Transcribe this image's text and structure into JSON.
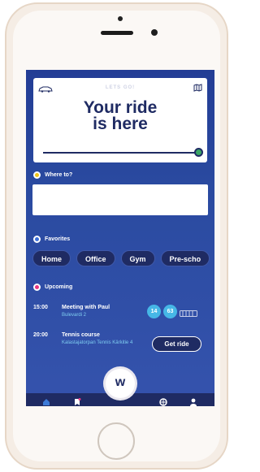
{
  "card": {
    "tagline": "LETS GO!",
    "title": "Your ride is here",
    "ride_progress": 1.0
  },
  "destination": {
    "label": "Where to?",
    "value": "",
    "placeholder": ""
  },
  "favorites": {
    "label": "Favorites",
    "items": [
      "Home",
      "Office",
      "Gym",
      "Pre-scho"
    ]
  },
  "upcoming": {
    "label": "Upcoming",
    "events": [
      {
        "time": "15:00",
        "title": "Meeting with Paul",
        "location": "Bulevardi 2",
        "badges": [
          "14",
          "63"
        ],
        "icon": "tram-icon"
      },
      {
        "time": "20:00",
        "title": "Tennis course",
        "location": "Kalastajatorpan Tennis Kärkitie 4",
        "action": "Get ride"
      }
    ]
  },
  "tabbar": {
    "center_logo": "w",
    "icons": [
      "home-icon",
      "document-icon",
      "ball-icon",
      "user-icon"
    ]
  },
  "colors": {
    "navy": "#1f2b63",
    "blue_bg": "#2a4aa0",
    "accent_green": "#3aa564",
    "badge_blue": "#46b7e6",
    "dest_dot": "#f0c419",
    "fav_dot": "#3c6fd8",
    "upcoming_dot": "#e8357f"
  }
}
